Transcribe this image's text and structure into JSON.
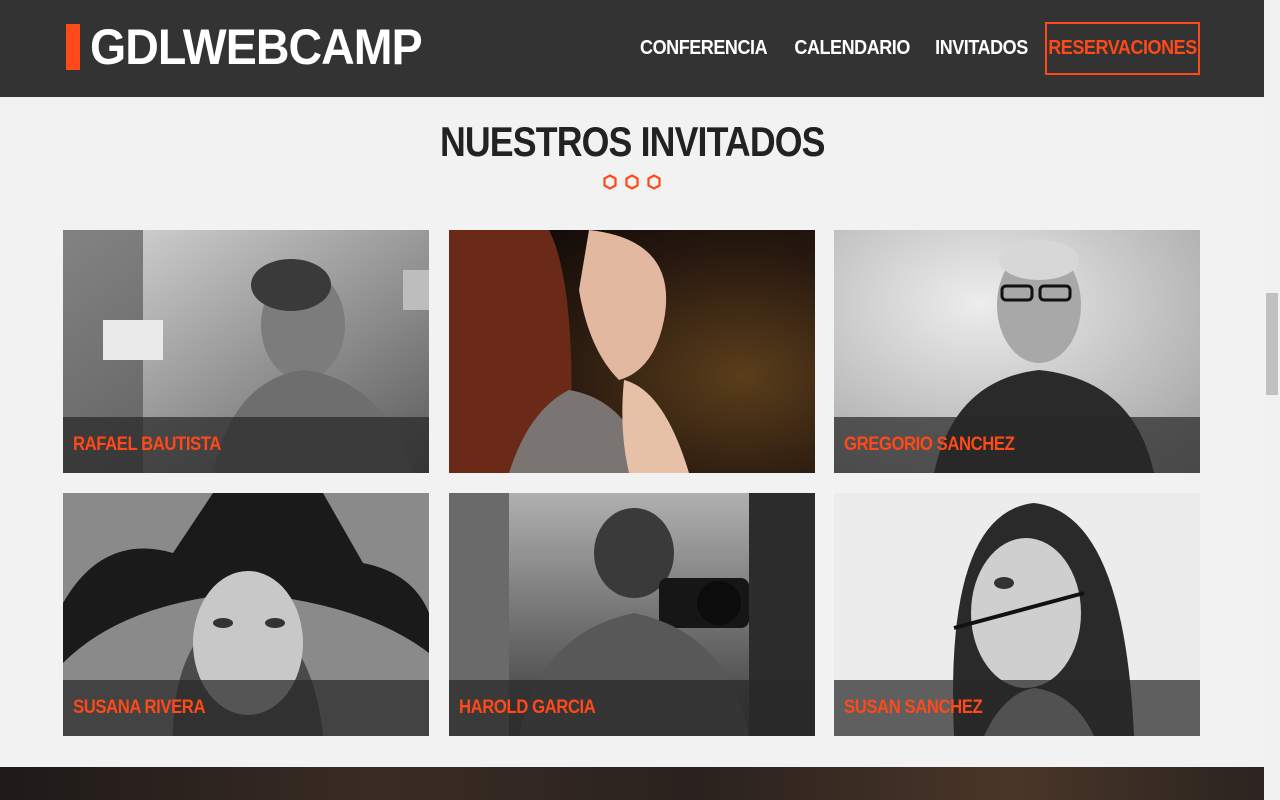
{
  "header": {
    "logo": "GDLWEBCAMP",
    "nav": [
      {
        "label": "CONFERENCIA"
      },
      {
        "label": "CALENDARIO"
      },
      {
        "label": "INVITADOS"
      },
      {
        "label": "RESERVACIONES"
      }
    ]
  },
  "section": {
    "title": "NUESTROS INVITADOS"
  },
  "guests": [
    {
      "name": "RAFAEL BAUTISTA",
      "photo": "man-at-desk-portrait"
    },
    {
      "name": "",
      "photo": "red-haired-woman-portrait"
    },
    {
      "name": "GREGORIO SANCHEZ",
      "photo": "man-with-glasses-portrait"
    },
    {
      "name": "SUSANA RIVERA",
      "photo": "woman-with-hat-portrait"
    },
    {
      "name": "HAROLD GARCIA",
      "photo": "man-with-camera-portrait"
    },
    {
      "name": "SUSAN SANCHEZ",
      "photo": "woman-with-pencil-portrait"
    }
  ],
  "colors": {
    "accent": "#fe4918",
    "header_bg": "#333333",
    "page_bg": "#f2f2f2"
  }
}
